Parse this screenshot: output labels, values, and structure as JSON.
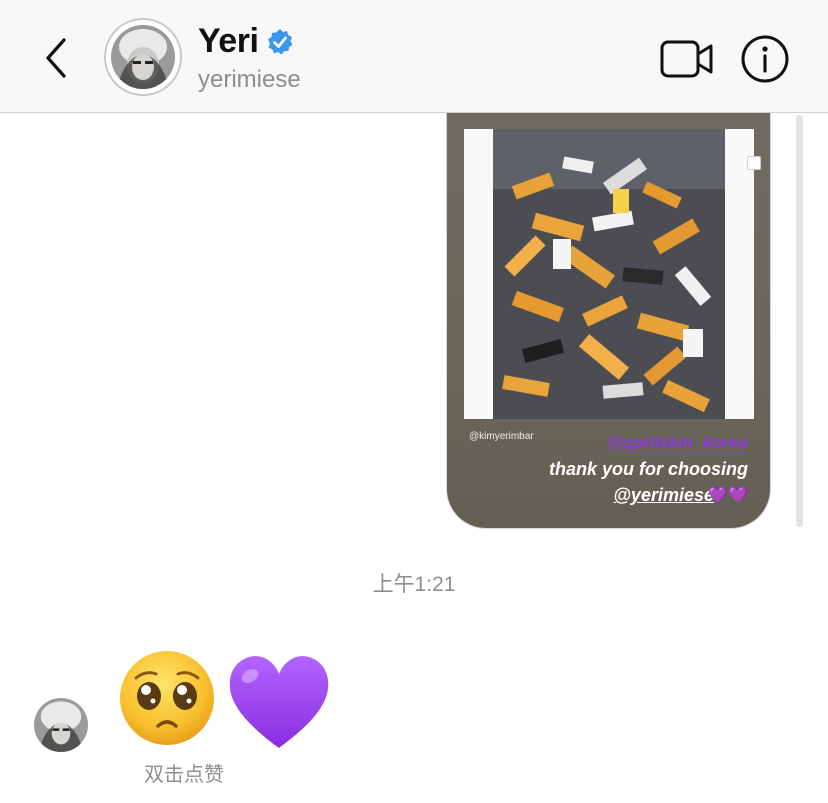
{
  "header": {
    "name": "Yeri",
    "handle": "yerimiese",
    "verified": true,
    "icons": {
      "back": "chevron-left-icon",
      "verified": "verified-badge-icon",
      "video": "video-camera-icon",
      "info": "info-circle-icon"
    }
  },
  "story": {
    "credit": "@kimyerimbar",
    "tag": "@aprilskin_korea",
    "line2": "thank you for choosing",
    "line3": "@yerimiese",
    "hearts": "💜💜"
  },
  "timestamp": "上午1:21",
  "message": {
    "emoji": [
      "pleading-face",
      "purple-heart"
    ],
    "hint": "双击点赞"
  },
  "colors": {
    "verified_blue": "#3897f0",
    "story_purple": "#8a3ddb",
    "heart_purple": "#9b4de0"
  }
}
